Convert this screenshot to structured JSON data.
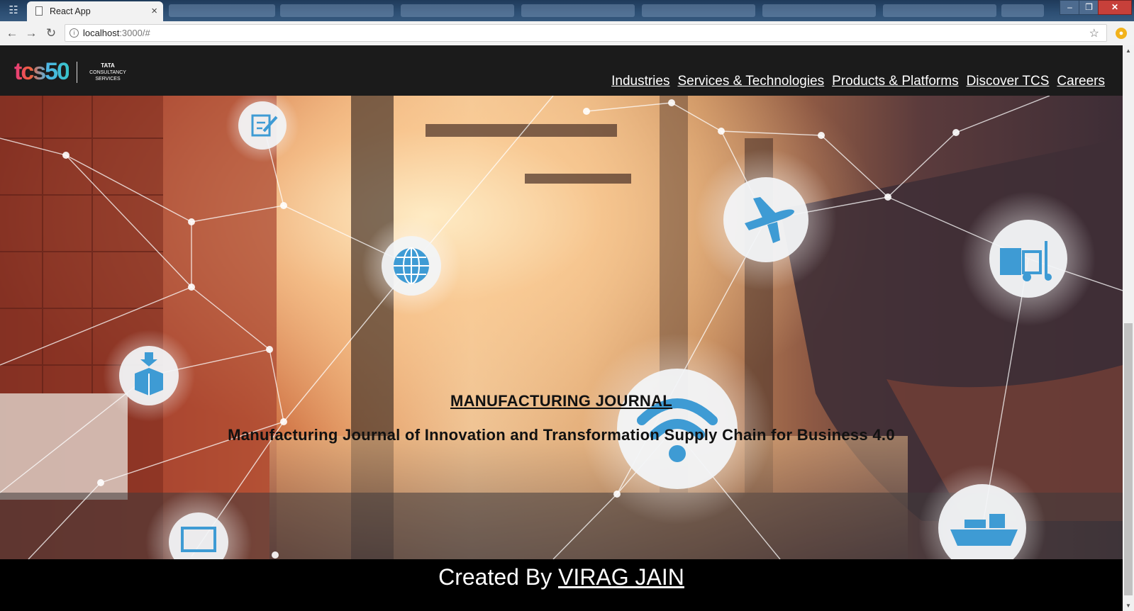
{
  "browser": {
    "tab_title": "React App",
    "tab_close": "×",
    "url_host": "localhost",
    "url_rest": ":3000/#",
    "back_icon": "arrow-left-icon",
    "forward_icon": "arrow-right-icon",
    "reload_icon": "reload-icon",
    "bookmark_icon": "star-icon",
    "window_minimize": "–",
    "window_maximize": "❐",
    "window_close": "✕"
  },
  "header": {
    "logo_mark": "tcs50",
    "logo_brand_line1": "TATA",
    "logo_brand_line2": "CONSULTANCY",
    "logo_brand_line3": "SERVICES",
    "nav": [
      "Industries",
      "Services & Technologies",
      "Products & Platforms",
      "Discover TCS",
      "Careers"
    ]
  },
  "hero": {
    "title": "MANUFACTURING JOURNAL",
    "subtitle": "Manufacturing Journal of Innovation and Transformation Supply Chain for Business 4.0",
    "icons": [
      "document-icon",
      "globe-icon",
      "airplane-icon",
      "forklift-icon",
      "package-icon",
      "wifi-icon",
      "monitor-icon",
      "ship-icon"
    ]
  },
  "footer": {
    "prefix": "Created By",
    "author": "VIRAG JAIN"
  },
  "colors": {
    "header_bg": "#1b1b1b",
    "footer_bg": "#000000",
    "icon_blue": "#3e9bd4"
  }
}
